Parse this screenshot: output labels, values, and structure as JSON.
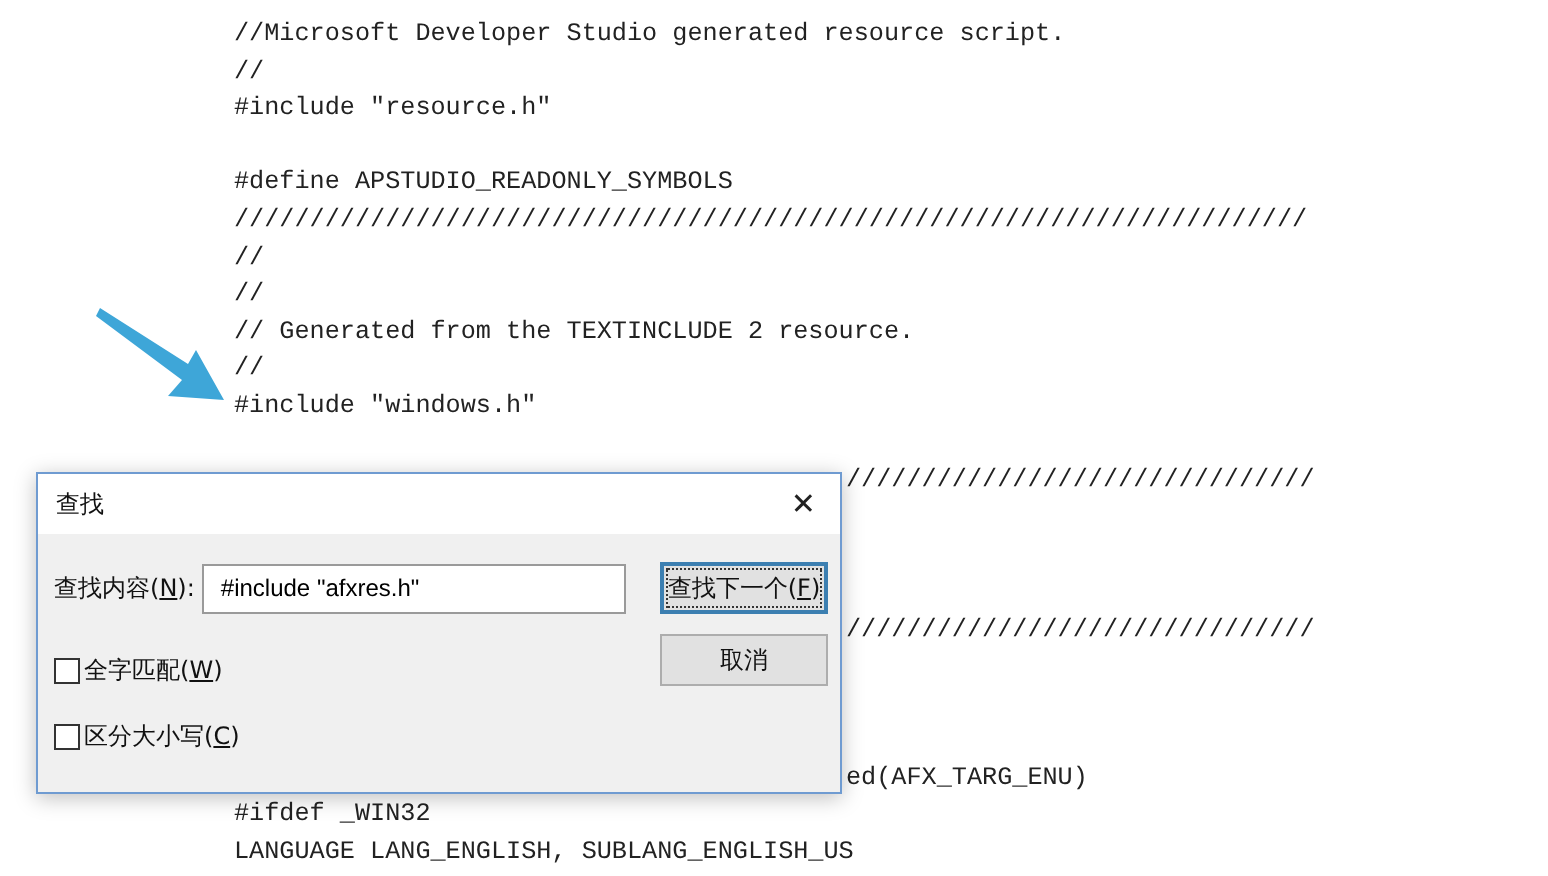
{
  "editor": {
    "lines": [
      {
        "kind": "code",
        "text": "//Microsoft Developer Studio generated resource script."
      },
      {
        "kind": "code",
        "text": "//"
      },
      {
        "kind": "code",
        "text": "#include ″resource.h″"
      },
      {
        "kind": "blank"
      },
      {
        "kind": "code",
        "text": "#define APSTUDIO_READONLY_SYMBOLS"
      },
      {
        "kind": "code",
        "text": "///////////////////////////////////////////////////////////////////////"
      },
      {
        "kind": "code",
        "text": "//"
      },
      {
        "kind": "code",
        "text": "//"
      },
      {
        "kind": "code",
        "text": "// Generated from the TEXTINCLUDE 2 resource."
      },
      {
        "kind": "code",
        "text": "//"
      },
      {
        "kind": "code",
        "text": "#include ″windows.h″"
      },
      {
        "kind": "blank"
      },
      {
        "kind": "partial",
        "text": "///////////////////////////////"
      },
      {
        "kind": "blank"
      },
      {
        "kind": "blank"
      },
      {
        "kind": "blank"
      },
      {
        "kind": "partial",
        "text": "///////////////////////////////"
      },
      {
        "kind": "blank"
      },
      {
        "kind": "blank"
      },
      {
        "kind": "blank"
      },
      {
        "kind": "partial",
        "text": "ed(AFX_TARG_ENU)"
      },
      {
        "kind": "code",
        "text": "#ifdef _WIN32"
      },
      {
        "kind": "code",
        "text": "LANGUAGE LANG_ENGLISH, SUBLANG_ENGLISH_US"
      }
    ]
  },
  "find_dialog": {
    "title": "查找",
    "close": "✕",
    "find_field": {
      "label": {
        "before": "查找内容(",
        "access_key": "N",
        "after": "):"
      },
      "value": "#include \"afxres.h\""
    },
    "options": [
      {
        "label": {
          "before": "全字匹配(",
          "access_key": "W",
          "after": ")"
        },
        "checked": false
      },
      {
        "label": {
          "before": "区分大小写(",
          "access_key": "C",
          "after": ")"
        },
        "checked": false
      }
    ],
    "buttons": [
      {
        "label": {
          "before": "查找下一个(",
          "access_key": "F",
          "after": ")"
        },
        "focused": true
      },
      {
        "label": {
          "before": "取消"
        },
        "focused": false
      }
    ]
  }
}
